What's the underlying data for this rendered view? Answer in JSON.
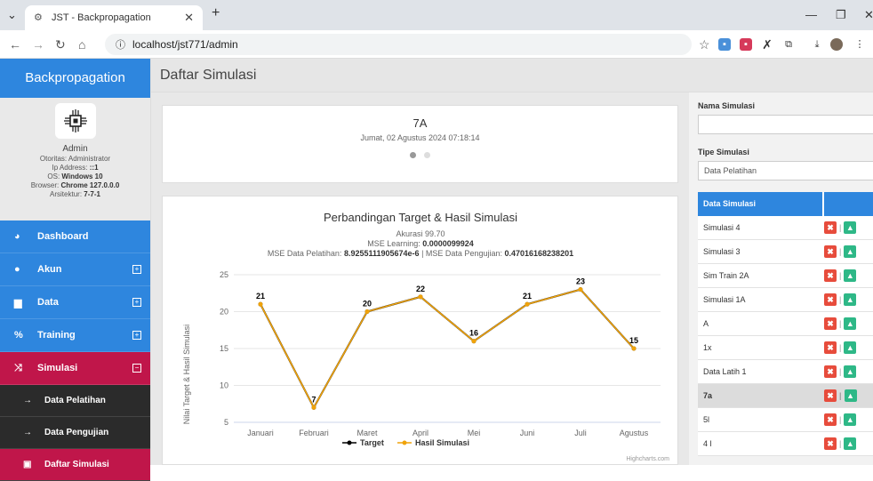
{
  "browser": {
    "tab_title": "JST - Backpropagation",
    "url": "localhost/jst771/admin"
  },
  "sidebar": {
    "brand": "Backpropagation",
    "profile": {
      "name": "Admin",
      "otoritas_label": "Otoritas: Administrator",
      "ip_label": "Ip Address:",
      "ip_value": "::1",
      "os_label": "OS:",
      "os_value": "Windows 10",
      "browser_label": "Browser:",
      "browser_value": "Chrome 127.0.0.0",
      "arch_label": "Arsitektur:",
      "arch_value": "7-7-1"
    },
    "menu": [
      {
        "label": "Dashboard",
        "icon": "dashboard-icon"
      },
      {
        "label": "Akun",
        "icon": "user-icon",
        "toggle": "⊞"
      },
      {
        "label": "Data",
        "icon": "data-icon",
        "toggle": "⊞"
      },
      {
        "label": "Training",
        "icon": "training-icon",
        "toggle": "⊞"
      },
      {
        "label": "Simulasi",
        "icon": "shuffle-icon",
        "toggle": "⊟"
      }
    ],
    "submenu": [
      {
        "label": "Data Pelatihan"
      },
      {
        "label": "Data Pengujian"
      },
      {
        "label": "Daftar Simulasi"
      }
    ]
  },
  "header": {
    "title": "Daftar Simulasi"
  },
  "carousel": {
    "title": "7A",
    "date": "Jumat, 02 Agustus 2024 07:18:14"
  },
  "chart_data": {
    "type": "line",
    "title": "Perbandingan Target & Hasil Simulasi",
    "subtitle_line1": "Akurasi 99.70",
    "subtitle_line2_label": "MSE Learning:",
    "subtitle_line2_value": "0.0000099924",
    "subtitle_line3_label1": "MSE Data Pelatihan:",
    "subtitle_line3_value1": "8.9255111905674e-6",
    "subtitle_line3_sep": "|",
    "subtitle_line3_label2": "MSE Data Pengujian:",
    "subtitle_line3_value2": "0.47016168238201",
    "ylabel": "Nilai Target & Hasil Simulasi",
    "categories": [
      "Januari",
      "Februari",
      "Maret",
      "April",
      "Mei",
      "Juni",
      "Juli",
      "Agustus"
    ],
    "yticks": [
      5,
      10,
      15,
      20,
      25
    ],
    "ylim": [
      5,
      25
    ],
    "series": [
      {
        "name": "Target",
        "color": "#000000",
        "values": [
          21,
          7,
          20,
          22,
          16,
          21,
          23,
          15
        ]
      },
      {
        "name": "Hasil Simulasi",
        "color": "#f0a30a",
        "values": [
          21,
          7,
          20,
          22,
          16,
          21,
          23,
          15
        ]
      }
    ],
    "credits": "Highcharts.com"
  },
  "form": {
    "nama_label": "Nama Simulasi",
    "nama_value": "",
    "tipe_label": "Tipe Simulasi",
    "tipe_value": "Data Pelatihan"
  },
  "table": {
    "header": "Data Simulasi",
    "rows": [
      "Simulasi 4",
      "Simulasi 3",
      "Sim Train 2A",
      "Simulasi 1A",
      "A",
      "1x",
      "Data Latih 1",
      "7a",
      "5l",
      "4 l"
    ]
  }
}
